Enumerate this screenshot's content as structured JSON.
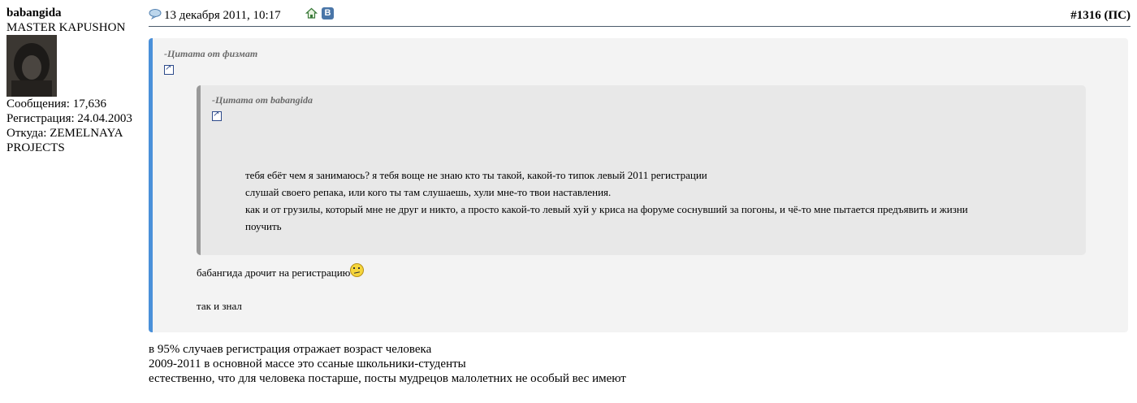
{
  "user": {
    "name": "babangida",
    "title": "MASTER KAPUSHON",
    "posts": "Сообщения: 17,636",
    "registered": "Регистрация: 24.04.2003",
    "location_line1": "Откуда: ZEMELNAYA",
    "location_line2": "PROJECTS"
  },
  "post": {
    "date": "13 декабря 2011, 10:17",
    "number_label": "#1316",
    "number_suffix": "(ПС)",
    "vk_label": "В"
  },
  "quote_outer": {
    "title": "-Цитата от физмат",
    "line1": "бабангида дрочит на регистрацию",
    "line2": "так и знал"
  },
  "quote_inner": {
    "title": "-Цитата от babangida",
    "lines": [
      "тебя ебёт чем я занимаюсь? я тебя воще не знаю кто ты такой, какой-то типок левый 2011 регистрации",
      "слушай своего репака, или кого ты там слушаешь, хули мне-то твои наставления.",
      "как и от грузилы, который мне не друг и никто, а просто какой-то левый хуй у криса на форуме соснувший за погоны, и чё-то мне пытается предъявить и жизни",
      "поучить"
    ]
  },
  "body": {
    "lines": [
      "в 95% случаев регистрация отражает возраст человека",
      "2009-2011 в основной массе это ссаные школьники-студенты",
      "естественно, что для человека постарше, посты мудрецов малолетних не особый вес имеют"
    ]
  }
}
